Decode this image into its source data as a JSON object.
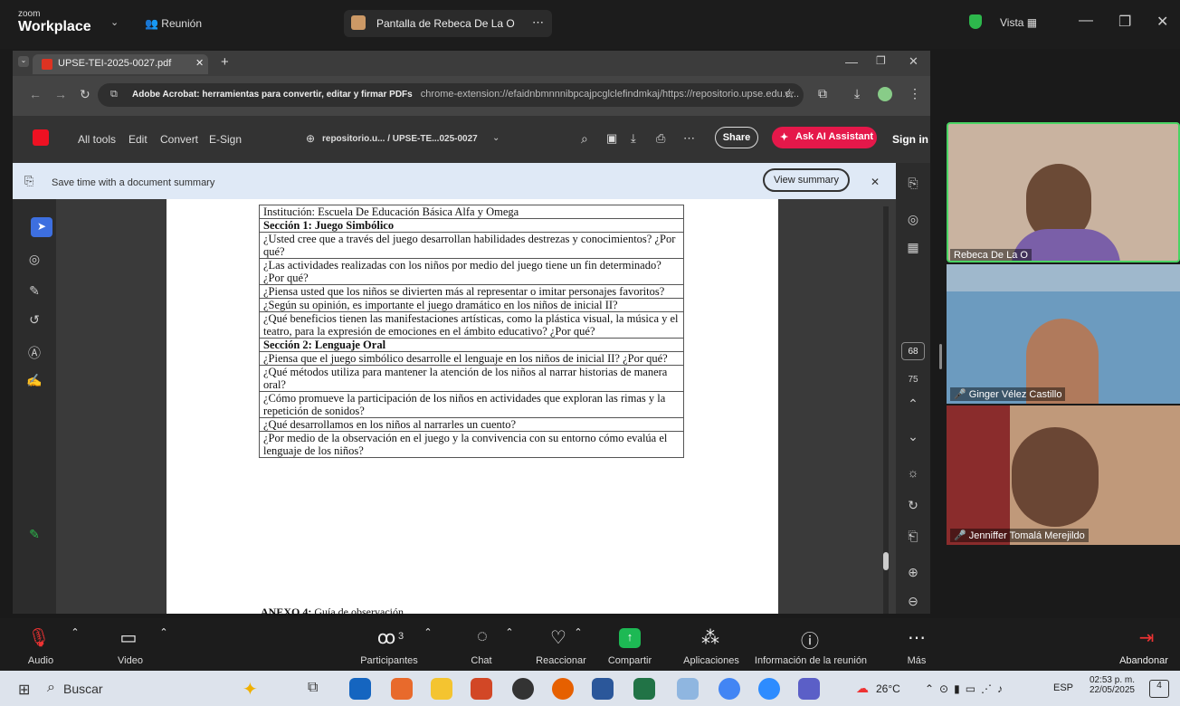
{
  "zoom": {
    "logo_top": "zoom",
    "logo_bottom": "Workplace",
    "meeting_label": "Reunión",
    "share_title": "Pantalla de Rebeca De La O",
    "view_label": "Vista"
  },
  "browser": {
    "tab_title": "UPSE-TEI-2025-0027.pdf",
    "url_prefix": "Adobe Acrobat: herramientas para convertir, editar y firmar PDFs",
    "url": "chrome-extension://efaidnbmnnnibpcajpcglclefindmkaj/https://repositorio.upse.edu.e..."
  },
  "acrobat": {
    "menu": [
      "All tools",
      "Edit",
      "Convert",
      "E-Sign"
    ],
    "doc_path": "repositorio.u... / UPSE-TE...025-0027",
    "share_label": "Share",
    "ai_label": "Ask AI Assistant",
    "signin_label": "Sign in",
    "summary_text": "Save time with a document summary",
    "view_summary_label": "View summary",
    "page_number": "68",
    "page_total": "75"
  },
  "document": {
    "rows": [
      {
        "text": "Institución: Escuela De Educación Básica Alfa y Omega",
        "bold": false
      },
      {
        "text": "Sección 1: Juego Simbólico",
        "bold": true
      },
      {
        "text": "¿Usted cree que a través del juego desarrollan habilidades destrezas y conocimientos? ¿Por qué?",
        "bold": false
      },
      {
        "text": "¿Las actividades realizadas con los niños por medio del juego tiene un fin determinado? ¿Por qué?",
        "bold": false
      },
      {
        "text": "¿Piensa usted que los niños se divierten más al representar o imitar personajes favoritos?",
        "bold": false
      },
      {
        "text": "¿Según su opinión, es importante el juego dramático en los niños de inicial II?",
        "bold": false
      },
      {
        "text": "¿Qué beneficios tienen las manifestaciones artísticas, como la plástica visual, la música y el teatro, para la expresión de emociones en el ámbito educativo? ¿Por qué?",
        "bold": false
      },
      {
        "text": "Sección 2: Lenguaje Oral",
        "bold": true
      },
      {
        "text": "¿Piensa que el juego simbólico desarrolle el lenguaje en los niños de inicial II? ¿Por qué?",
        "bold": false
      },
      {
        "text": "¿Qué métodos utiliza para mantener la atención de los niños al narrar historias de manera oral?",
        "bold": false
      },
      {
        "text": "¿Cómo promueve la participación de los niños en actividades que exploran las rimas y la repetición de sonidos?",
        "bold": false
      },
      {
        "text": "¿Qué desarrollamos en los niños al narrarles un cuento?",
        "bold": false
      },
      {
        "text": "¿Por medio de la observación en el juego y la convivencia con su entorno cómo evalúa el lenguaje de los niños?",
        "bold": false
      }
    ],
    "annex_bold": "ANEXO 4:",
    "annex_rest": " Guía de observación"
  },
  "participants": [
    {
      "name": "Rebeca De La O"
    },
    {
      "name": "Ginger Vélez Castillo"
    },
    {
      "name": "Jenniffer Tomalá Merejildo"
    }
  ],
  "controls": {
    "audio": "Audio",
    "video": "Video",
    "participants": "Participantes",
    "participants_count": "3",
    "chat": "Chat",
    "react": "Reaccionar",
    "share": "Compartir",
    "apps": "Aplicaciones",
    "info": "Información de la reunión",
    "more": "Más",
    "leave": "Abandonar"
  },
  "taskbar": {
    "search": "Buscar",
    "weather": "26°C",
    "lang": "ESP",
    "time": "02:53 p. m.",
    "date": "22/05/2025",
    "notif_count": "4"
  }
}
